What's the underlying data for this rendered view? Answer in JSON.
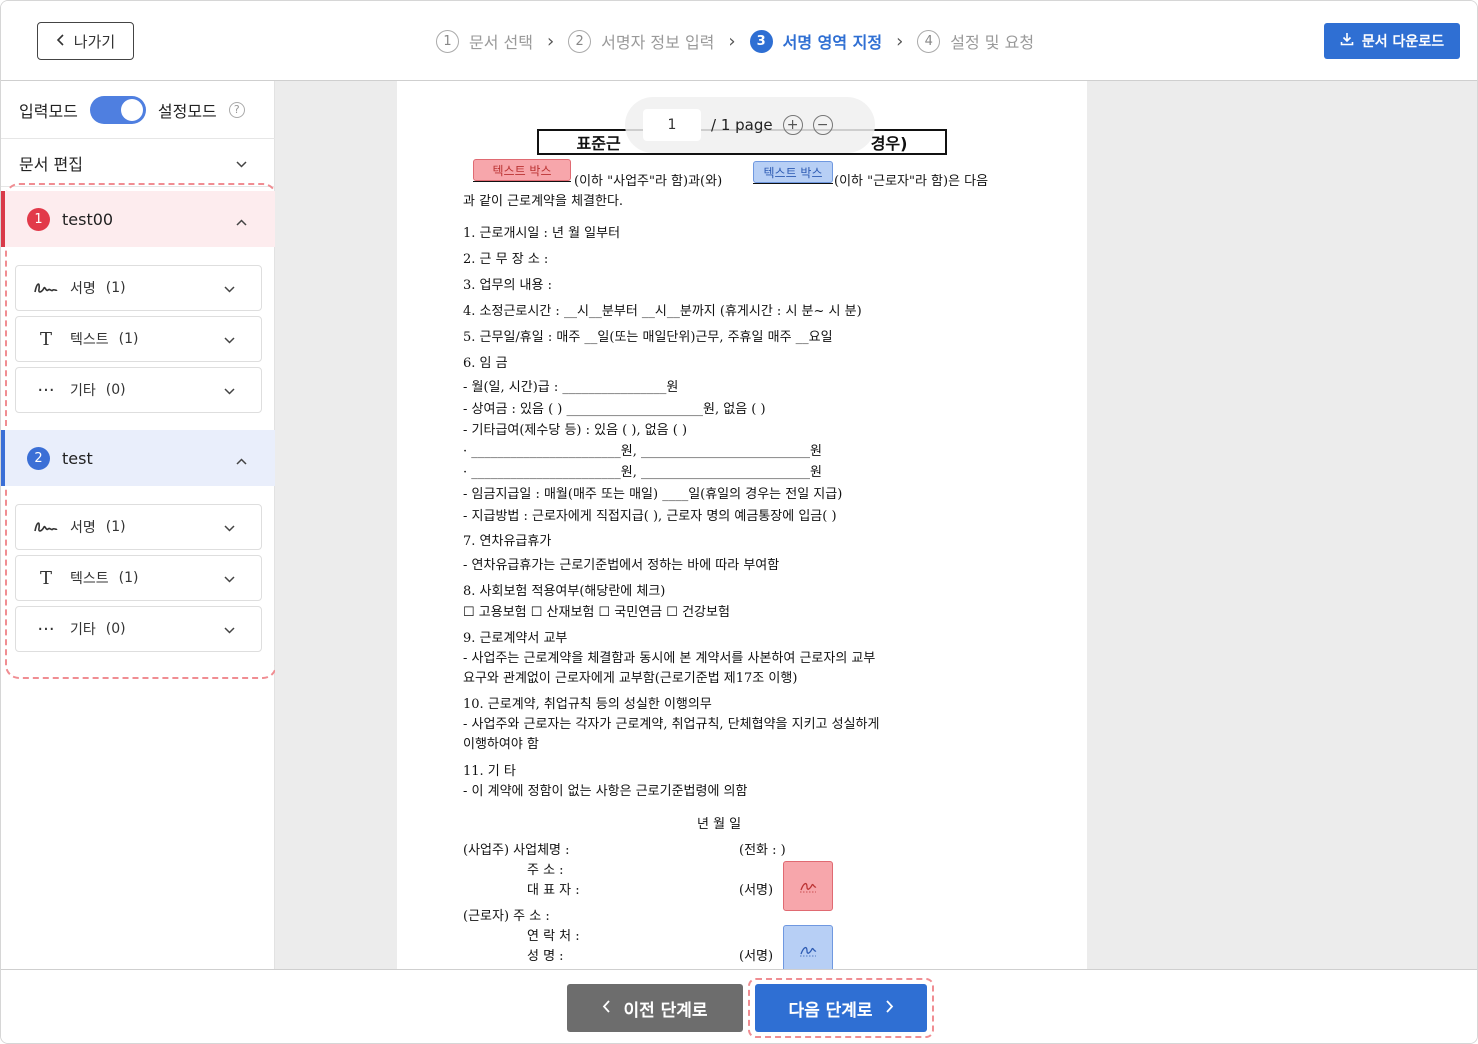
{
  "header": {
    "back_label": "나가기",
    "steps": [
      {
        "num": "1",
        "label": "문서 선택"
      },
      {
        "num": "2",
        "label": "서명자 정보 입력"
      },
      {
        "num": "3",
        "label": "서명 영역 지정"
      },
      {
        "num": "4",
        "label": "설정 및 요청"
      }
    ],
    "active_step": 3,
    "download_label": "문서 다운로드"
  },
  "sidebar": {
    "mode_input": "입력모드",
    "mode_setting": "설정모드",
    "help_glyph": "?",
    "doc_edit": "문서 편집",
    "signers": [
      {
        "num": "1",
        "name": "test00",
        "color": "#e23a4a",
        "fields": [
          {
            "icon": "signature-icon",
            "label": "서명",
            "count": "(1)"
          },
          {
            "icon": "text-icon",
            "label": "텍스트",
            "count": "(1)"
          },
          {
            "icon": "more-icon",
            "label": "기타",
            "count": "(0)"
          }
        ]
      },
      {
        "num": "2",
        "name": "test",
        "color": "#3b6fd6",
        "fields": [
          {
            "icon": "signature-icon",
            "label": "서명",
            "count": "(1)"
          },
          {
            "icon": "text-icon",
            "label": "텍스트",
            "count": "(1)"
          },
          {
            "icon": "more-icon",
            "label": "기타",
            "count": "(0)"
          }
        ]
      }
    ]
  },
  "viewer": {
    "page_number": "1",
    "page_total": "/ 1 page",
    "zoom_in": "+",
    "zoom_out": "−",
    "doc": {
      "title_left": "표준근",
      "title_right": "경우)",
      "textbox_label": "텍스트 박스",
      "intro_a": "(이하 \"사업주\"라 함)과(와)",
      "intro_b": "(이하 \"근로자\"라 함)은 다음",
      "intro_c": "과 같이 근로계약을 체결한다.",
      "lines": [
        "1. 근로개시일 :        년     월     일부터",
        "2. 근 무 장 소 :",
        "3. 업무의 내용 :",
        "4. 소정근로시간 : __시__분부터 __시__분까지 (휴게시간 :  시  분~  시   분)",
        "5. 근무일/휴일 : 매주 __일(또는 매일단위)근무, 주휴일 매주 __요일",
        "6. 임   금",
        "  - 월(일, 시간)급 : ________________원",
        "  - 상여금 : 있음 (     ) _____________________원,   없음 (       )",
        "  - 기타급여(제수당 등) : 있음 (      ),    없음 (      )",
        "     · _______________________원,   __________________________원",
        "     · _______________________원,   __________________________원",
        "  - 임금지급일 : 매월(매주 또는 매일)    ____일(휴일의 경우는 전일 지급)",
        "  - 지급방법 : 근로자에게 직접지급(     ),  근로자 명의 예금통장에 입금(     )",
        "7. 연차유급휴가",
        "  - 연차유급휴가는 근로기준법에서 정하는 바에 따라 부여함",
        "8. 사회보험 적용여부(해당란에 체크)",
        "  ☐ 고용보험   ☐ 산재보험   ☐ 국민연금   ☐ 건강보험",
        "9. 근로계약서 교부",
        "  - 사업주는 근로계약을 체결함과 동시에 본 계약서를 사본하여 근로자의 교부",
        "    요구와 관계없이 근로자에게 교부함(근로기준법 제17조 이행)",
        "10. 근로계약, 취업규칙 등의 성실한 이행의무",
        "  - 사업주와 근로자는 각자가 근로계약, 취업규칙, 단체협약을 지키고 성실하게",
        "    이행하여야 함",
        "11. 기   타",
        "  - 이 계약에 정함이 없는 사항은 근로기준법령에 의함"
      ],
      "date_line": "년        월        일",
      "employer_lines": [
        "(사업주) 사업체명 :",
        "주       소 :",
        "대  표  자 :"
      ],
      "phone": "(전화 :                              )",
      "sign_label": "(서명)",
      "worker_lines": [
        "(근로자) 주       소 :",
        "연  락  처 :",
        "성       명 :"
      ]
    }
  },
  "footer": {
    "prev_label": "이전 단계로",
    "next_label": "다음 단계로"
  }
}
